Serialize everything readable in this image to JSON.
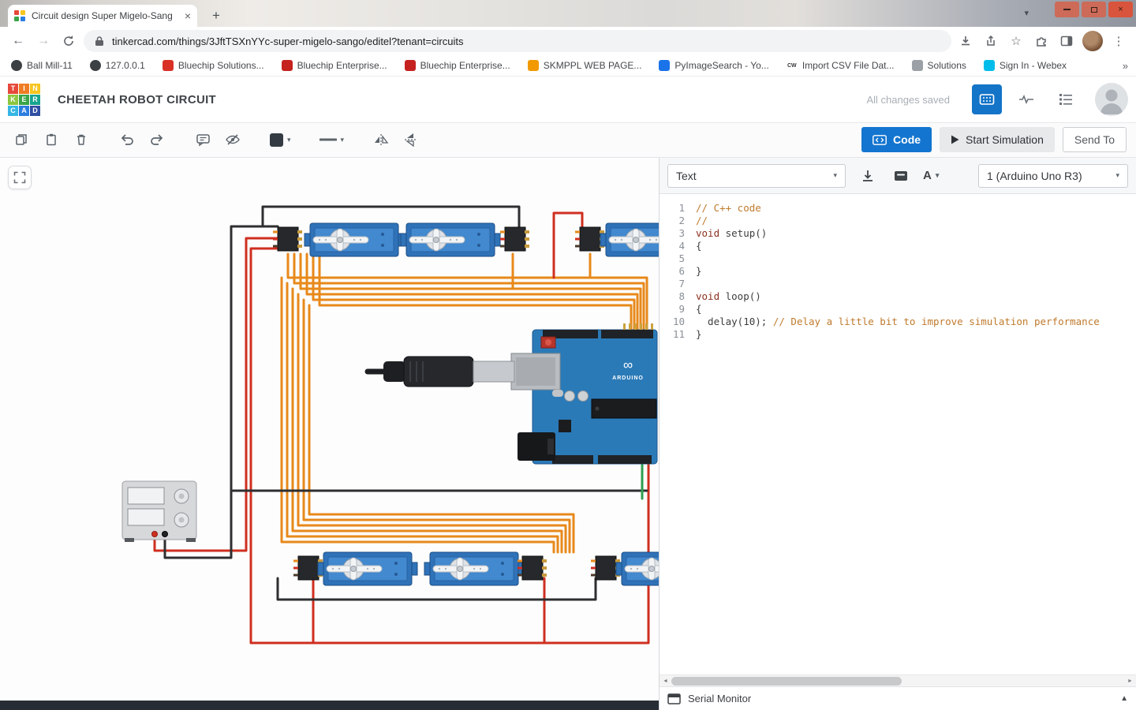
{
  "browser": {
    "tab": {
      "title": "Circuit design Super Migelo-Sang"
    },
    "url": "tinkercad.com/things/3JftTSXnYYc-super-migelo-sango/editel?tenant=circuits",
    "bookmarks": [
      {
        "label": "Ball Mill-11",
        "type": "globe"
      },
      {
        "label": "127.0.0.1",
        "type": "globe"
      },
      {
        "label": "Bluechip Solutions...",
        "type": "color",
        "color": "#d93025"
      },
      {
        "label": "Bluechip Enterprise...",
        "type": "color",
        "color": "#c5221f"
      },
      {
        "label": "Bluechip Enterprise...",
        "type": "color",
        "color": "#c5221f"
      },
      {
        "label": "SKMPPL WEB PAGE...",
        "type": "color",
        "color": "#f29900"
      },
      {
        "label": "PyImageSearch - Yo...",
        "type": "color",
        "color": "#1a73e8"
      },
      {
        "label": "Import CSV File Dat...",
        "type": "text",
        "text": "CW"
      },
      {
        "label": "Solutions",
        "type": "color",
        "color": "#9aa0a6"
      },
      {
        "label": "Sign In - Webex",
        "type": "color",
        "color": "#00bceb"
      }
    ],
    "bookmarks_overflow": "»"
  },
  "app": {
    "title": "CHEETAH ROBOT CIRCUIT",
    "save_status": "All changes saved",
    "logo": [
      {
        "t": "T",
        "c": "#e6493a"
      },
      {
        "t": "I",
        "c": "#ef7c22"
      },
      {
        "t": "N",
        "c": "#f7c51e"
      },
      {
        "t": "K",
        "c": "#8dc63f"
      },
      {
        "t": "E",
        "c": "#3aa548"
      },
      {
        "t": "R",
        "c": "#17a48e"
      },
      {
        "t": "C",
        "c": "#35b6e4"
      },
      {
        "t": "A",
        "c": "#2a7de1"
      },
      {
        "t": "D",
        "c": "#2f4fa2"
      }
    ]
  },
  "toolbar": {
    "code": "Code",
    "start_simulation": "Start Simulation",
    "send_to": "Send To"
  },
  "code_panel": {
    "mode": "Text",
    "board": "1 (Arduino Uno R3)",
    "serial_monitor": "Serial Monitor",
    "lines": [
      {
        "n": "1",
        "tokens": [
          {
            "t": "// C++ code",
            "c": "cm"
          }
        ]
      },
      {
        "n": "2",
        "tokens": [
          {
            "t": "//",
            "c": "cm"
          }
        ]
      },
      {
        "n": "3",
        "tokens": [
          {
            "t": "void",
            "c": "kw"
          },
          {
            "t": " setup()",
            "c": "pl"
          }
        ]
      },
      {
        "n": "4",
        "tokens": [
          {
            "t": "{",
            "c": "pl"
          }
        ]
      },
      {
        "n": "5",
        "tokens": []
      },
      {
        "n": "6",
        "tokens": [
          {
            "t": "}",
            "c": "pl"
          }
        ]
      },
      {
        "n": "7",
        "tokens": []
      },
      {
        "n": "8",
        "tokens": [
          {
            "t": "void",
            "c": "kw"
          },
          {
            "t": " loop()",
            "c": "pl"
          }
        ]
      },
      {
        "n": "9",
        "tokens": [
          {
            "t": "{",
            "c": "pl"
          }
        ]
      },
      {
        "n": "10",
        "tokens": [
          {
            "t": "  delay(10); ",
            "c": "pl"
          },
          {
            "t": "// Delay a little bit to improve simulation performance",
            "c": "cm"
          }
        ]
      },
      {
        "n": "11",
        "tokens": [
          {
            "t": "}",
            "c": "pl"
          }
        ]
      }
    ]
  },
  "circuit": {
    "board_text": "ARDUINO",
    "board_logo": "∞"
  }
}
